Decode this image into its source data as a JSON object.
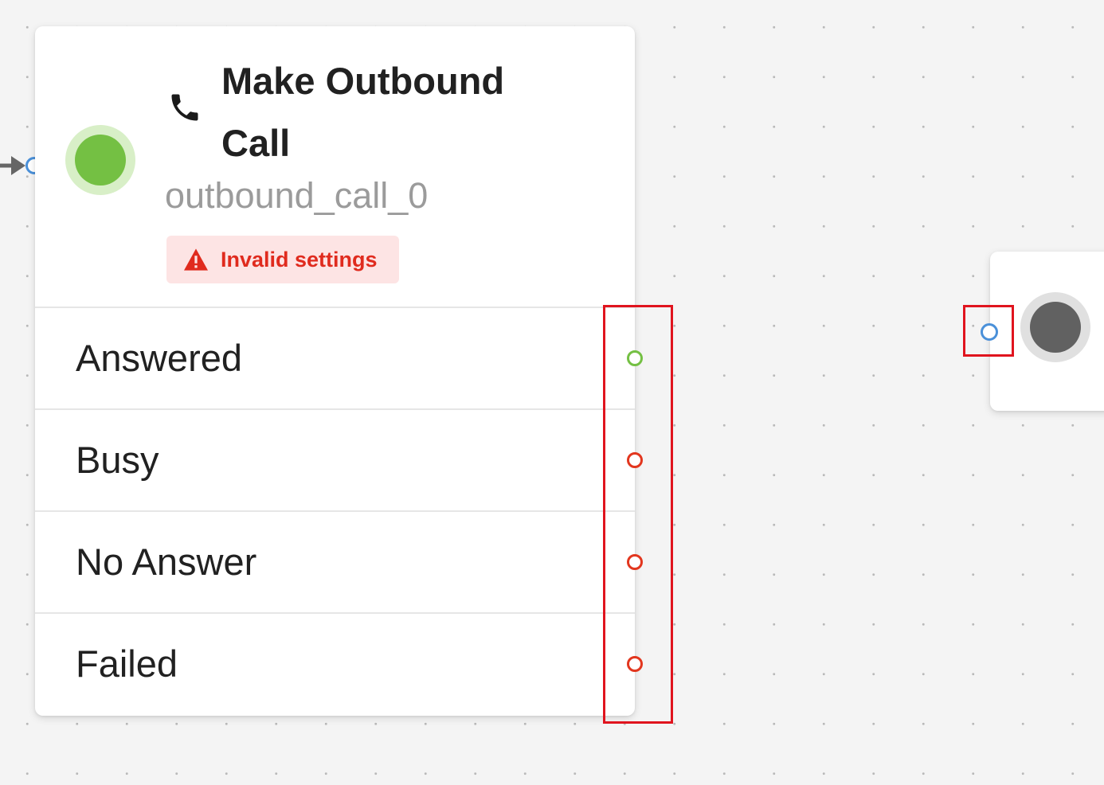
{
  "node": {
    "title": "Make Outbound Call",
    "subtitle": "outbound_call_0",
    "status_color": "#74c043",
    "icon": "phone-icon",
    "warning": {
      "icon": "warning-triangle-icon",
      "label": "Invalid settings",
      "color": "#e02b1e"
    },
    "outcomes": [
      {
        "label": "Answered",
        "port_color": "#74c043"
      },
      {
        "label": "Busy",
        "port_color": "#e2361e"
      },
      {
        "label": "No Answer",
        "port_color": "#e2361e"
      },
      {
        "label": "Failed",
        "port_color": "#e2361e"
      }
    ]
  },
  "next_node": {
    "status_color": "#616161"
  },
  "colors": {
    "input_port": "#4a90d9",
    "highlight": "#e0141e",
    "canvas": "#f4f4f4"
  }
}
